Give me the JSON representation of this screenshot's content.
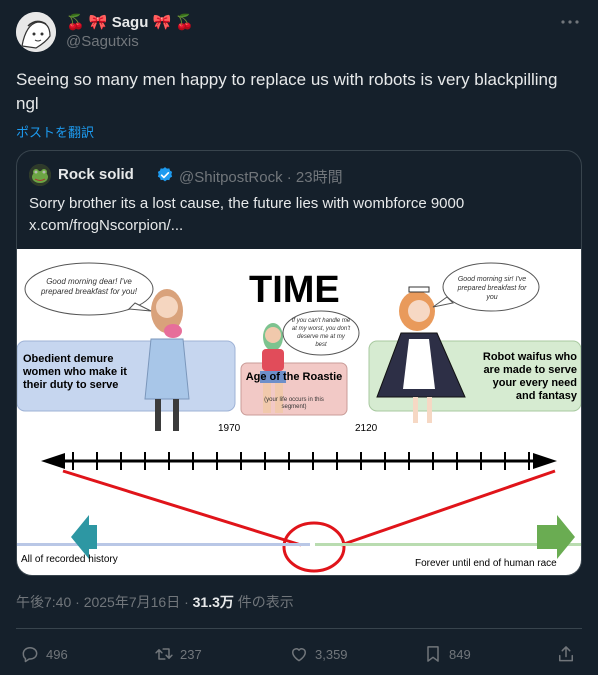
{
  "author": {
    "display_name": "🍒 🎀 Sagu 🎀 🍒",
    "handle": "@Sagutxis"
  },
  "tweet": {
    "text": "Seeing so many men happy to replace us with robots is very blackpilling ngl",
    "translate_label": "ポストを翻訳"
  },
  "quote": {
    "display_name": "Rock solid",
    "handle_time": "@ShitpostRock · 23時間",
    "text": "Sorry brother its a lost cause, the future lies with wombforce 9000  x.com/frogNscorpion/...",
    "image": {
      "title": "TIME",
      "left_bubble": "Good morning dear! I've prepared breakfast for you!",
      "left_box": "Obedient demure women who make it their duty to serve",
      "middle_bubble": "If you can't handle me at my worst, you don't deserve me at my best",
      "middle_box_title": "Age of the Roastie",
      "middle_box_sub": "(your life occurs in this segment)",
      "right_bubble": "Good morning sir! I've prepared breakfast for you",
      "right_box": "Robot waifus who are made to serve your every need and fantasy",
      "year_left": "1970",
      "year_right": "2120",
      "bottom_left": "All of recorded history",
      "bottom_right": "Forever until end of human race"
    }
  },
  "meta": {
    "time_date": "午後7:40 · 2025年7月16日 · ",
    "views_count": "31.3万",
    "views_label": " 件の表示"
  },
  "actions": {
    "replies": "496",
    "reposts": "237",
    "likes": "3,359",
    "bookmarks": "849"
  },
  "colors": {
    "background": "#15202b",
    "accent": "#1d9bf0",
    "muted": "#71767b"
  }
}
